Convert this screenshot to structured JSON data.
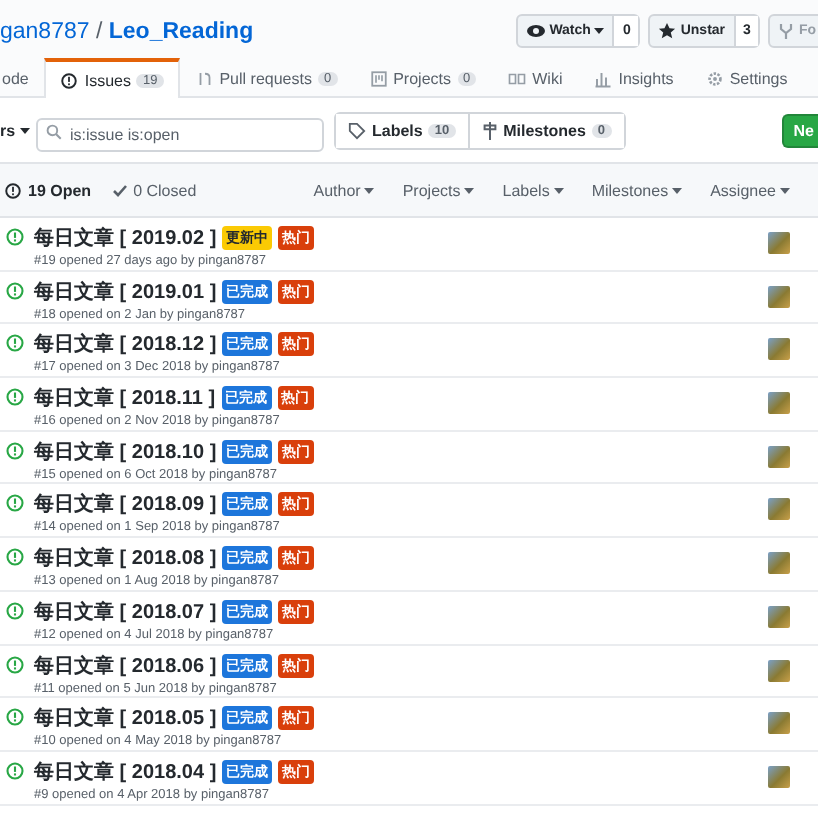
{
  "repo": {
    "owner": "gan8787",
    "separator": "/",
    "name": "Leo_Reading"
  },
  "actions": [
    {
      "label": "Watch",
      "count": "0",
      "kind": "watch"
    },
    {
      "label": "Unstar",
      "count": "3",
      "kind": "star"
    },
    {
      "label": "Fo",
      "kind": "fork"
    }
  ],
  "tabs": [
    {
      "label": "ode",
      "kind": "code",
      "selected": false
    },
    {
      "label": "Issues",
      "count": "19",
      "kind": "issue",
      "selected": true
    },
    {
      "label": "Pull requests",
      "count": "0",
      "kind": "pr",
      "selected": false
    },
    {
      "label": "Projects",
      "count": "0",
      "kind": "project",
      "selected": false
    },
    {
      "label": "Wiki",
      "kind": "wiki",
      "selected": false
    },
    {
      "label": "Insights",
      "kind": "insights",
      "selected": false
    },
    {
      "label": "Settings",
      "kind": "settings",
      "selected": false
    }
  ],
  "filters": {
    "label": "rs",
    "search": "is:issue is:open"
  },
  "labels_button": {
    "label": "Labels",
    "count": "10"
  },
  "milestones_button": {
    "label": "Milestones",
    "count": "0"
  },
  "new_button": "Ne",
  "list_header": {
    "open": "19 Open",
    "closed": "0 Closed",
    "sorts": [
      "Author",
      "Projects",
      "Labels",
      "Milestones",
      "Assignee"
    ]
  },
  "issues": [
    {
      "title": "每日文章 [ 2019.02 ]",
      "labels": [
        {
          "name": "更新中",
          "color": "#fbca04"
        },
        {
          "name": "热门",
          "color": "#d93f0b"
        }
      ],
      "meta": "#19 opened 27 days ago by pingan8787"
    },
    {
      "title": "每日文章 [ 2019.01 ]",
      "labels": [
        {
          "name": "已完成",
          "color": "#1d76db"
        },
        {
          "name": "热门",
          "color": "#d93f0b"
        }
      ],
      "meta": "#18 opened on 2 Jan by pingan8787"
    },
    {
      "title": "每日文章 [ 2018.12 ]",
      "labels": [
        {
          "name": "已完成",
          "color": "#1d76db"
        },
        {
          "name": "热门",
          "color": "#d93f0b"
        }
      ],
      "meta": "#17 opened on 3 Dec 2018 by pingan8787"
    },
    {
      "title": "每日文章 [ 2018.11 ]",
      "labels": [
        {
          "name": "已完成",
          "color": "#1d76db"
        },
        {
          "name": "热门",
          "color": "#d93f0b"
        }
      ],
      "meta": "#16 opened on 2 Nov 2018 by pingan8787"
    },
    {
      "title": "每日文章 [ 2018.10 ]",
      "labels": [
        {
          "name": "已完成",
          "color": "#1d76db"
        },
        {
          "name": "热门",
          "color": "#d93f0b"
        }
      ],
      "meta": "#15 opened on 6 Oct 2018 by pingan8787"
    },
    {
      "title": "每日文章 [ 2018.09 ]",
      "labels": [
        {
          "name": "已完成",
          "color": "#1d76db"
        },
        {
          "name": "热门",
          "color": "#d93f0b"
        }
      ],
      "meta": "#14 opened on 1 Sep 2018 by pingan8787"
    },
    {
      "title": "每日文章 [ 2018.08 ]",
      "labels": [
        {
          "name": "已完成",
          "color": "#1d76db"
        },
        {
          "name": "热门",
          "color": "#d93f0b"
        }
      ],
      "meta": "#13 opened on 1 Aug 2018 by pingan8787"
    },
    {
      "title": "每日文章 [ 2018.07 ]",
      "labels": [
        {
          "name": "已完成",
          "color": "#1d76db"
        },
        {
          "name": "热门",
          "color": "#d93f0b"
        }
      ],
      "meta": "#12 opened on 4 Jul 2018 by pingan8787"
    },
    {
      "title": "每日文章 [ 2018.06 ]",
      "labels": [
        {
          "name": "已完成",
          "color": "#1d76db"
        },
        {
          "name": "热门",
          "color": "#d93f0b"
        }
      ],
      "meta": "#11 opened on 5 Jun 2018 by pingan8787"
    },
    {
      "title": "每日文章 [ 2018.05 ]",
      "labels": [
        {
          "name": "已完成",
          "color": "#1d76db"
        },
        {
          "name": "热门",
          "color": "#d93f0b"
        }
      ],
      "meta": "#10 opened on 4 May 2018 by pingan8787"
    },
    {
      "title": "每日文章 [ 2018.04 ]",
      "labels": [
        {
          "name": "已完成",
          "color": "#1d76db"
        },
        {
          "name": "热门",
          "color": "#d93f0b"
        }
      ],
      "meta": "#9 opened on 4 Apr 2018 by pingan8787"
    }
  ]
}
